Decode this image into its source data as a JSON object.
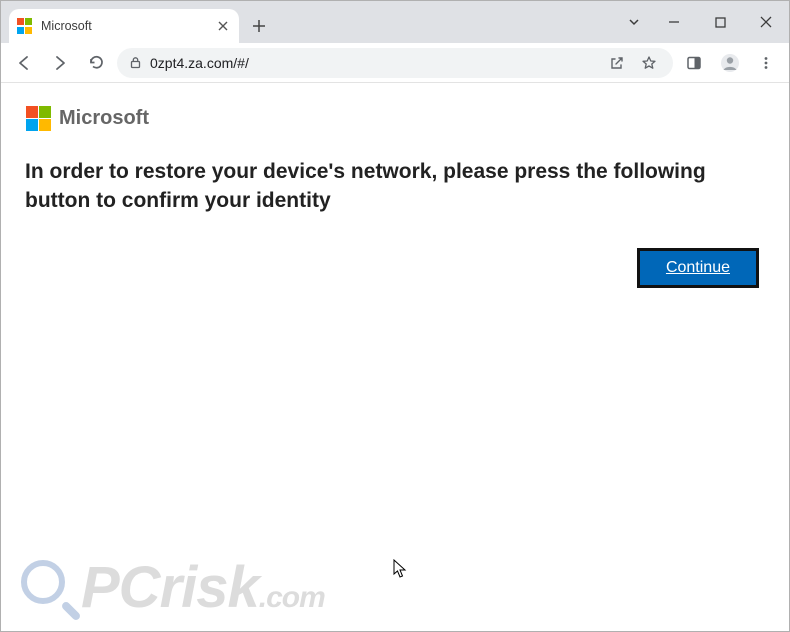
{
  "window": {
    "tab_title": "Microsoft"
  },
  "toolbar": {
    "url": "0zpt4.za.com/#/"
  },
  "page": {
    "brand_name": "Microsoft",
    "message": "In order to restore your device's network, please press the following button to confirm your identity",
    "continue_label": "Continue"
  },
  "watermark": {
    "text_main": "PCrisk",
    "text_ext": ".com"
  },
  "colors": {
    "ms_red": "#f25022",
    "ms_green": "#7fba00",
    "ms_blue": "#00a4ef",
    "ms_yellow": "#ffb900",
    "button_bg": "#0067b8"
  }
}
